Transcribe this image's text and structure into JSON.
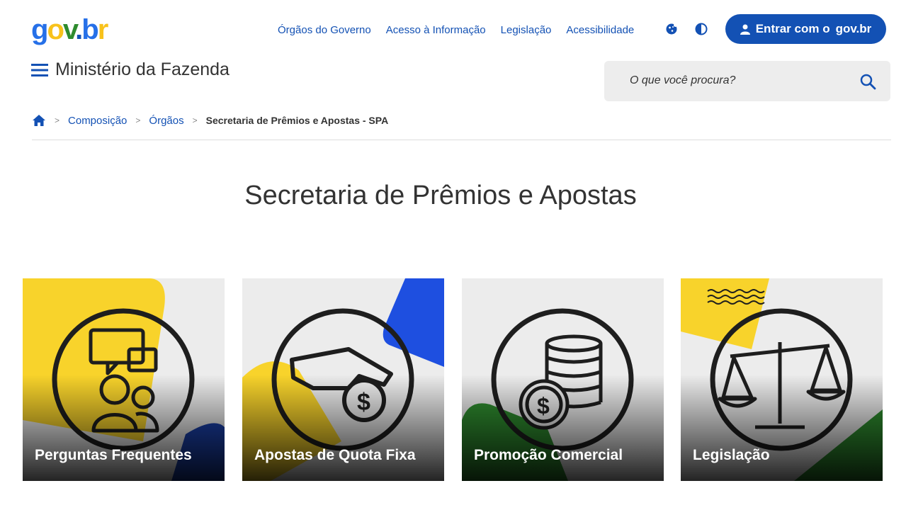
{
  "header": {
    "logo_text": "gov.br",
    "nav": [
      "Órgãos do Governo",
      "Acesso à Informação",
      "Legislação",
      "Acessibilidade"
    ],
    "icons": [
      "cookie-icon",
      "contrast-icon"
    ],
    "login_label": "Entrar com o",
    "login_brand": "gov.br",
    "colors": {
      "primary": "#1351b4",
      "yellow": "#f8d32b",
      "green": "#2e8b2e"
    }
  },
  "ministry": {
    "title": "Ministério da Fazenda"
  },
  "search": {
    "placeholder": "O que você procura?"
  },
  "breadcrumb": {
    "items": [
      "Composição",
      "Órgãos"
    ],
    "current": "Secretaria de Prêmios e Apostas - SPA"
  },
  "page": {
    "title": "Secretaria de Prêmios e Apostas"
  },
  "cards": [
    {
      "label": "Perguntas Frequentes",
      "icon": "chat-people-icon"
    },
    {
      "label": "Apostas de Quota Fixa",
      "icon": "hand-coin-icon"
    },
    {
      "label": "Promoção Comercial",
      "icon": "coins-stack-icon"
    },
    {
      "label": "Legislação",
      "icon": "scales-icon"
    }
  ]
}
